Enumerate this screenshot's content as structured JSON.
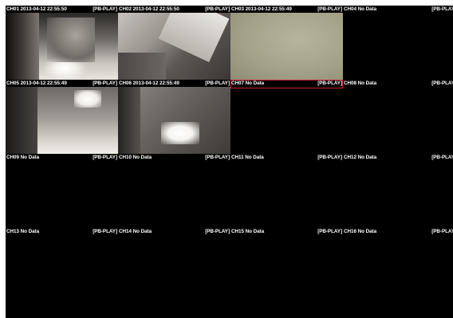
{
  "tiles": [
    {
      "label": "CH01 2013-04-12 22:55:50",
      "status": "[PB-PLAY]"
    },
    {
      "label": "CH02 2013-04-12 22:55:50",
      "status": "[PB-PLAY]"
    },
    {
      "label": "CH03 2013-04-12 22:55:49",
      "status": "[PB-PLAY]"
    },
    {
      "label": "CH04 No Data",
      "status": "[PB-PLAY"
    },
    {
      "label": "CH05 2013-04-12 22:55:49",
      "status": "[PB-PLAY]"
    },
    {
      "label": "CH06 2013-04-12 22:55:49",
      "status": "[PB-PLAY]"
    },
    {
      "label": "CH07 No Data",
      "status": "[PB-PLAY]"
    },
    {
      "label": "CH08 No Data",
      "status": "[PB-PLAY"
    },
    {
      "label": "CH09 No Data",
      "status": "[PB-PLAY]"
    },
    {
      "label": "CH10 No Data",
      "status": "[PB-PLAY]"
    },
    {
      "label": "CH11 No Data",
      "status": "[PB-PLAY]"
    },
    {
      "label": "CH12 No Data",
      "status": "[PB-PLAY"
    },
    {
      "label": "CH13 No Data",
      "status": "[PB-PLAY]"
    },
    {
      "label": "CH14 No Data",
      "status": "[PB-PLAY]"
    },
    {
      "label": "CH15 No Data",
      "status": "[PB-PLAY]"
    },
    {
      "label": "CH16 No Data",
      "status": "[PB-PLAY"
    }
  ],
  "selection_color": "#c4222a"
}
